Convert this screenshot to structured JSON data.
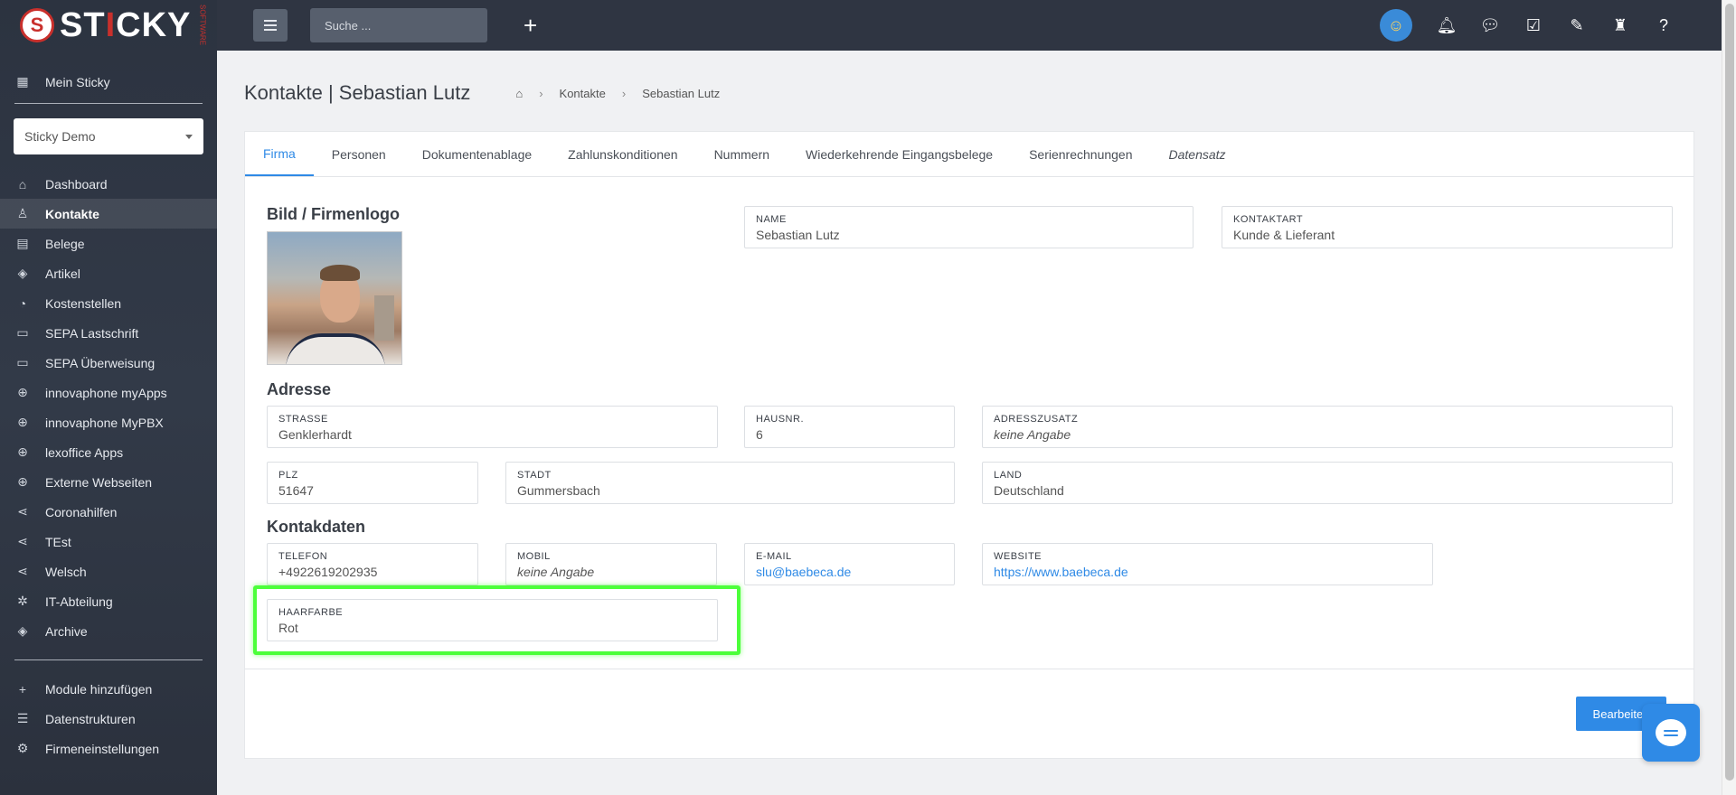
{
  "brand": {
    "name_pre": "ST",
    "name_i": "I",
    "name_post": "CKY",
    "tag": "SOFTWARE"
  },
  "sidebar": {
    "home_label": "Mein Sticky",
    "company_select": "Sticky Demo",
    "items": [
      {
        "label": "Dashboard",
        "icon": "home-icon"
      },
      {
        "label": "Kontakte",
        "icon": "contacts-icon",
        "active": true
      },
      {
        "label": "Belege",
        "icon": "document-icon"
      },
      {
        "label": "Artikel",
        "icon": "box-icon"
      },
      {
        "label": "Kostenstellen",
        "icon": "pie-icon"
      },
      {
        "label": "SEPA Lastschrift",
        "icon": "card-icon"
      },
      {
        "label": "SEPA Überweisung",
        "icon": "card-icon"
      },
      {
        "label": "innovaphone myApps",
        "icon": "globe-icon"
      },
      {
        "label": "innovaphone MyPBX",
        "icon": "globe-icon"
      },
      {
        "label": "lexoffice Apps",
        "icon": "globe-icon"
      },
      {
        "label": "Externe Webseiten",
        "icon": "globe-icon"
      },
      {
        "label": "Coronahilfen",
        "icon": "share-icon"
      },
      {
        "label": "TEst",
        "icon": "share-icon"
      },
      {
        "label": "Welsch",
        "icon": "share-icon"
      },
      {
        "label": "IT-Abteilung",
        "icon": "network-icon"
      },
      {
        "label": "Archive",
        "icon": "box-icon"
      }
    ],
    "bottom_items": [
      {
        "label": "Module hinzufügen",
        "icon": "plus-icon"
      },
      {
        "label": "Datenstrukturen",
        "icon": "database-icon"
      },
      {
        "label": "Firmeneinstellungen",
        "icon": "gear-icon"
      }
    ]
  },
  "topbar": {
    "search_placeholder": "Suche ..."
  },
  "header": {
    "title": "Kontakte | Sebastian Lutz",
    "breadcrumb": [
      "Kontakte",
      "Sebastian Lutz"
    ]
  },
  "tabs": [
    "Firma",
    "Personen",
    "Dokumentenablage",
    "Zahlunskonditionen",
    "Nummern",
    "Wiederkehrende Eingangsbelege",
    "Serienrechnungen",
    "Datensatz"
  ],
  "sections": {
    "logo": "Bild / Firmenlogo",
    "address": "Adresse",
    "contact": "Kontakdaten"
  },
  "fields": {
    "name": {
      "label": "NAME",
      "value": "Sebastian Lutz"
    },
    "kontaktart": {
      "label": "KONTAKTART",
      "value": "Kunde & Lieferant"
    },
    "strasse": {
      "label": "STRASSE",
      "value": "Genklerhardt"
    },
    "hausnr": {
      "label": "HAUSNR.",
      "value": "6"
    },
    "adresszusatz": {
      "label": "ADRESSZUSATZ",
      "value": "keine Angabe"
    },
    "plz": {
      "label": "PLZ",
      "value": "51647"
    },
    "stadt": {
      "label": "STADT",
      "value": "Gummersbach"
    },
    "land": {
      "label": "LAND",
      "value": "Deutschland"
    },
    "telefon": {
      "label": "TELEFON",
      "value": "+4922619202935"
    },
    "mobil": {
      "label": "MOBIL",
      "value": "keine Angabe"
    },
    "email": {
      "label": "E-MAIL",
      "value": "slu@baebeca.de"
    },
    "website": {
      "label": "WEBSITE",
      "value": "https://www.baebeca.de"
    },
    "haarfarbe": {
      "label": "HAARFARBE",
      "value": "Rot"
    }
  },
  "actions": {
    "edit": "Bearbeiten"
  },
  "colors": {
    "accent": "#2f8ae6",
    "highlight": "#4cff3a",
    "sidebar": "#2c3340"
  }
}
